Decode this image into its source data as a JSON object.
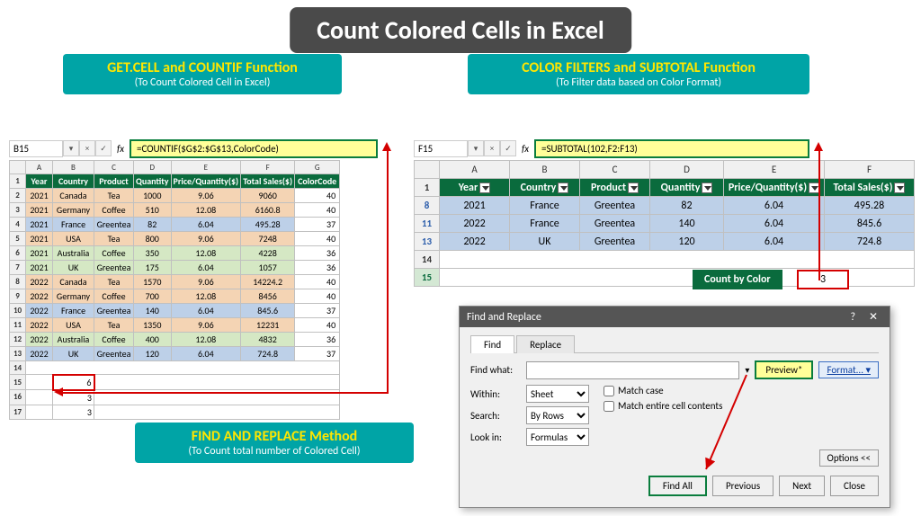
{
  "title": "Count Colored Cells in Excel",
  "labels": {
    "left": {
      "main": "GET.CELL and COUNTIF Function",
      "sub": "(To Count Colored Cell in Excel)"
    },
    "right": {
      "main": "COLOR FILTERS and SUBTOTAL Function",
      "sub": "(To Filter data based on Color Format)"
    },
    "bottom": {
      "main": "FIND AND REPLACE Method",
      "sub": "(To Count total number of Colored Cell)"
    }
  },
  "formulaBarLeft": {
    "name": "B15",
    "formula": "=COUNTIF($G$2:$G$13,ColorCode)"
  },
  "formulaBarRight": {
    "name": "F15",
    "formula": "=SUBTOTAL(102,F2:F13)"
  },
  "leftTable": {
    "cols": [
      "A",
      "B",
      "C",
      "D",
      "E",
      "F",
      "G"
    ],
    "headers": [
      "Year",
      "Country",
      "Product",
      "Quantity",
      "Price/Quantity($)",
      "Total Sales($)",
      "ColorCode"
    ],
    "rows": [
      {
        "r": "2",
        "color": "tan",
        "cells": [
          "2021",
          "Canada",
          "Tea",
          "1000",
          "9.06",
          "9060",
          "40"
        ]
      },
      {
        "r": "3",
        "color": "tan",
        "cells": [
          "2021",
          "Germany",
          "Coffee",
          "510",
          "12.08",
          "6160.8",
          "40"
        ]
      },
      {
        "r": "4",
        "color": "blue",
        "cells": [
          "2021",
          "France",
          "Greentea",
          "82",
          "6.04",
          "495.28",
          "37"
        ]
      },
      {
        "r": "5",
        "color": "tan",
        "cells": [
          "2021",
          "USA",
          "Tea",
          "800",
          "9.06",
          "7248",
          "40"
        ]
      },
      {
        "r": "6",
        "color": "green",
        "cells": [
          "2021",
          "Australia",
          "Coffee",
          "350",
          "12.08",
          "4228",
          "36"
        ]
      },
      {
        "r": "7",
        "color": "green",
        "cells": [
          "2021",
          "UK",
          "Greentea",
          "175",
          "6.04",
          "1057",
          "36"
        ]
      },
      {
        "r": "8",
        "color": "tan",
        "cells": [
          "2022",
          "Canada",
          "Tea",
          "1570",
          "9.06",
          "14224.2",
          "40"
        ]
      },
      {
        "r": "9",
        "color": "tan",
        "cells": [
          "2022",
          "Germany",
          "Coffee",
          "700",
          "12.08",
          "8456",
          "40"
        ]
      },
      {
        "r": "10",
        "color": "blue",
        "cells": [
          "2022",
          "France",
          "Greentea",
          "140",
          "6.04",
          "845.6",
          "37"
        ]
      },
      {
        "r": "11",
        "color": "tan",
        "cells": [
          "2022",
          "USA",
          "Tea",
          "1350",
          "9.06",
          "12231",
          "40"
        ]
      },
      {
        "r": "12",
        "color": "green",
        "cells": [
          "2022",
          "Australia",
          "Coffee",
          "400",
          "12.08",
          "4832",
          "36"
        ]
      },
      {
        "r": "13",
        "color": "blue",
        "cells": [
          "2022",
          "UK",
          "Greentea",
          "120",
          "6.04",
          "724.8",
          "37"
        ]
      }
    ],
    "results": [
      {
        "r": "15",
        "val": "6",
        "hl": true
      },
      {
        "r": "16",
        "val": "3",
        "hl": false
      },
      {
        "r": "17",
        "val": "3",
        "hl": false
      }
    ]
  },
  "rightTable": {
    "cols": [
      "A",
      "B",
      "C",
      "D",
      "E",
      "F"
    ],
    "headers": [
      "Year",
      "Country",
      "Product",
      "Quantity",
      "Price/Quantity($)",
      "Total Sales($)"
    ],
    "rows": [
      {
        "r": "8",
        "cells": [
          "2021",
          "France",
          "Greentea",
          "82",
          "6.04",
          "495.28"
        ]
      },
      {
        "r": "11",
        "cells": [
          "2022",
          "France",
          "Greentea",
          "140",
          "6.04",
          "845.6"
        ]
      },
      {
        "r": "13",
        "cells": [
          "2022",
          "UK",
          "Greentea",
          "120",
          "6.04",
          "724.8"
        ]
      }
    ],
    "emptyRows": [
      "14",
      "15"
    ],
    "countLabel": "Count by Color",
    "countVal": "3"
  },
  "dialog": {
    "title": "Find and Replace",
    "tabs": {
      "find": "Find",
      "replace": "Replace"
    },
    "findWhat": "Find what:",
    "preview": "Preview*",
    "format": "Format...",
    "within": {
      "label": "Within:",
      "value": "Sheet"
    },
    "search": {
      "label": "Search:",
      "value": "By Rows"
    },
    "lookIn": {
      "label": "Look in:",
      "value": "Formulas"
    },
    "matchCase": "Match case",
    "matchEntire": "Match entire cell contents",
    "options": "Options <<",
    "buttons": {
      "findAll": "Find All",
      "previous": "Previous",
      "next": "Next",
      "close": "Close"
    }
  },
  "chart_data": {
    "type": "table",
    "title": "Count Colored Cells in Excel — sample dataset",
    "columns": [
      "Year",
      "Country",
      "Product",
      "Quantity",
      "Price/Quantity($)",
      "Total Sales($)",
      "ColorCode"
    ],
    "rows": [
      [
        2021,
        "Canada",
        "Tea",
        1000,
        9.06,
        9060,
        40
      ],
      [
        2021,
        "Germany",
        "Coffee",
        510,
        12.08,
        6160.8,
        40
      ],
      [
        2021,
        "France",
        "Greentea",
        82,
        6.04,
        495.28,
        37
      ],
      [
        2021,
        "USA",
        "Tea",
        800,
        9.06,
        7248,
        40
      ],
      [
        2021,
        "Australia",
        "Coffee",
        350,
        12.08,
        4228,
        36
      ],
      [
        2021,
        "UK",
        "Greentea",
        175,
        6.04,
        1057,
        36
      ],
      [
        2022,
        "Canada",
        "Tea",
        1570,
        9.06,
        14224.2,
        40
      ],
      [
        2022,
        "Germany",
        "Coffee",
        700,
        12.08,
        8456,
        40
      ],
      [
        2022,
        "France",
        "Greentea",
        140,
        6.04,
        845.6,
        37
      ],
      [
        2022,
        "USA",
        "Tea",
        1350,
        9.06,
        12231,
        40
      ],
      [
        2022,
        "Australia",
        "Coffee",
        400,
        12.08,
        4832,
        36
      ],
      [
        2022,
        "UK",
        "Greentea",
        120,
        6.04,
        724.8,
        37
      ]
    ],
    "counts_by_colorcode": {
      "40": 6,
      "37": 3,
      "36": 3
    }
  }
}
